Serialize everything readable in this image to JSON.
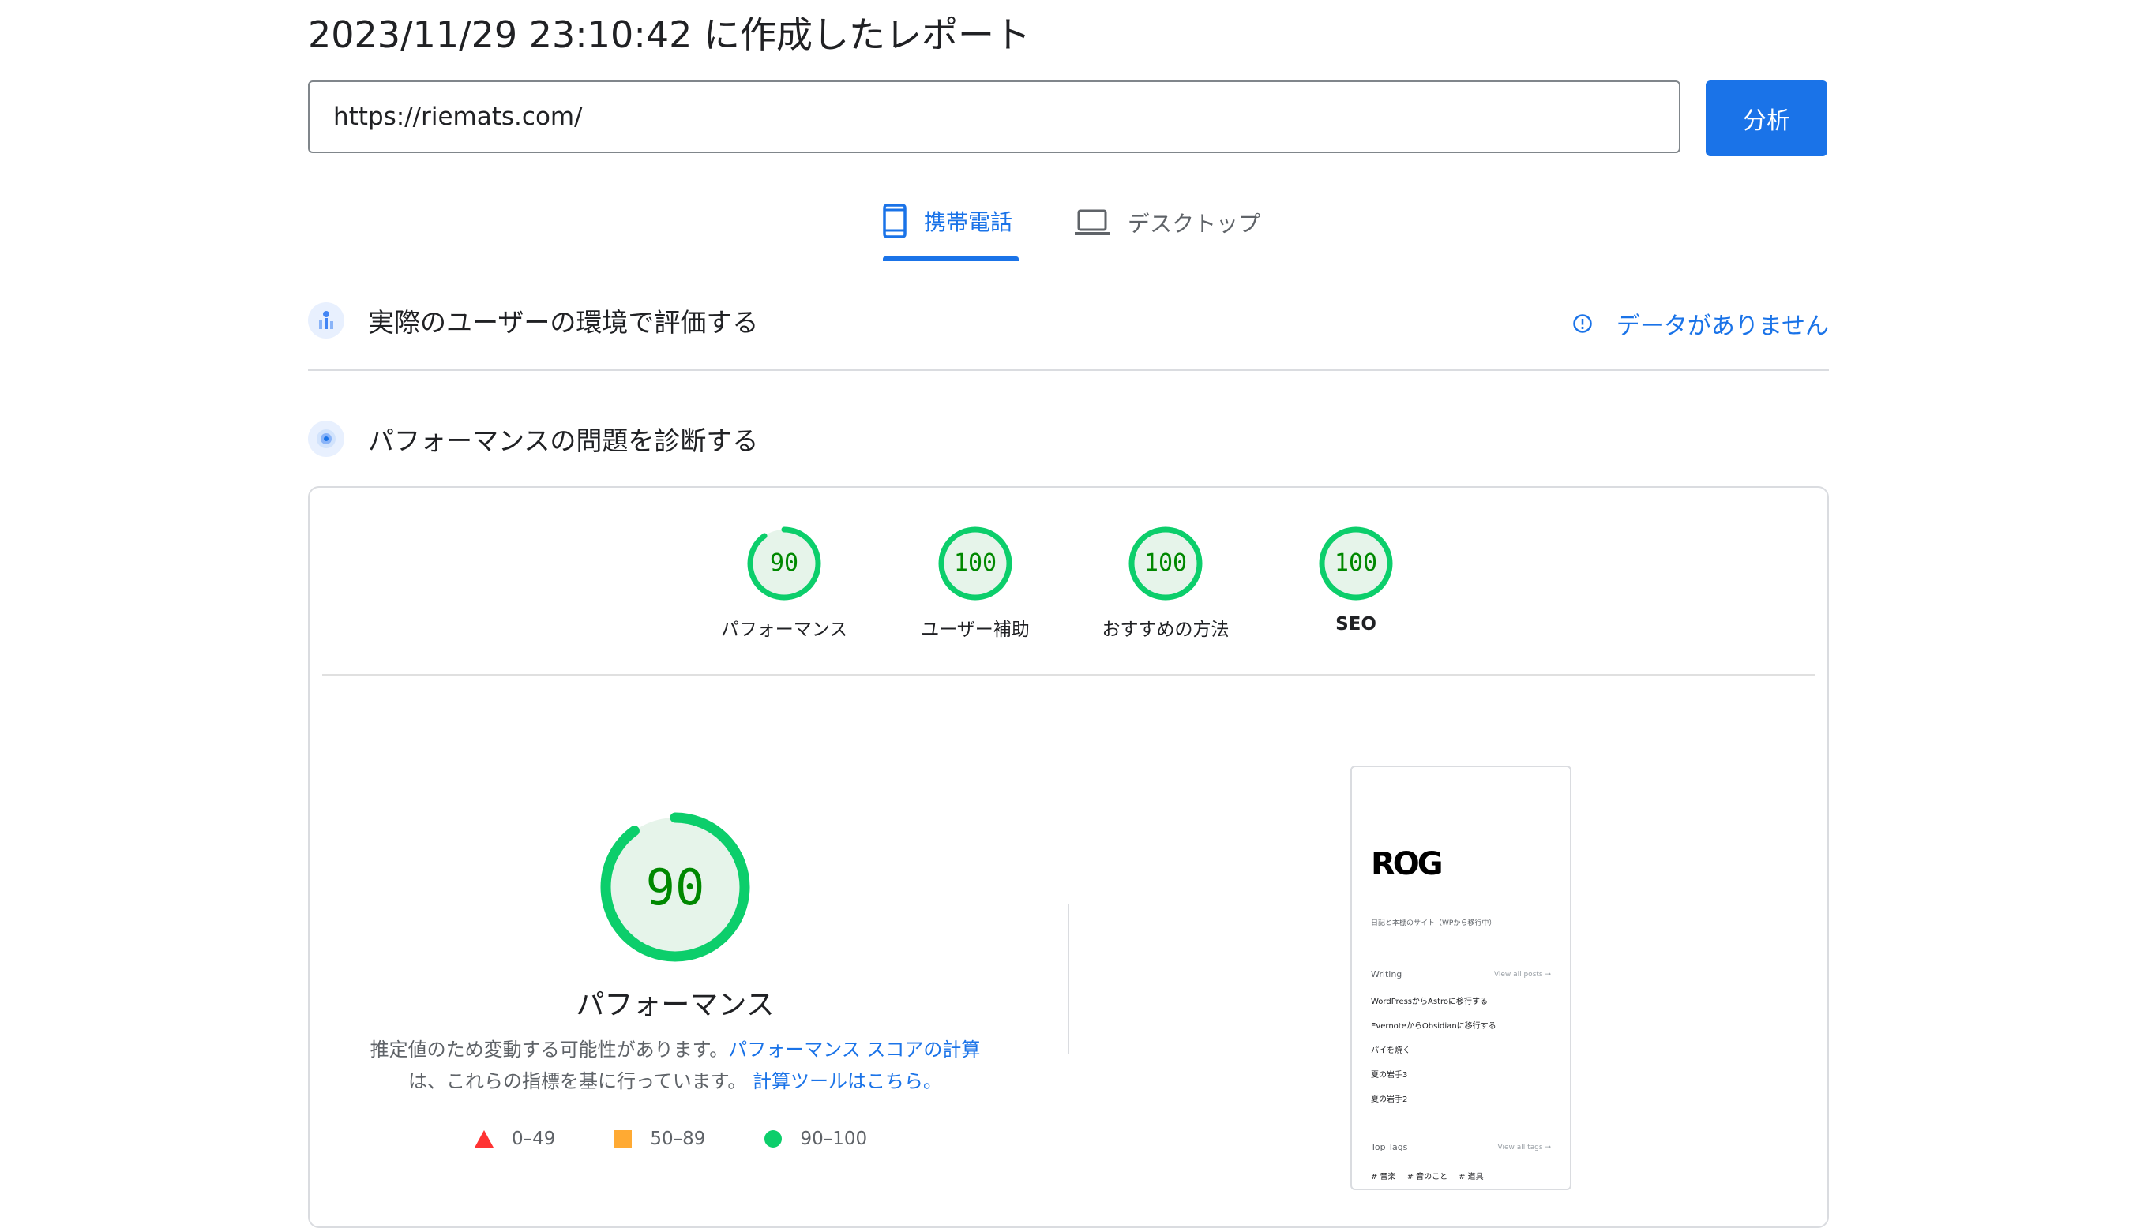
{
  "report": {
    "title": "2023/11/29 23:10:42 に作成したレポート"
  },
  "search": {
    "url_value": "https://riemats.com/",
    "analyze_label": "分析"
  },
  "tabs": [
    {
      "label": "携帯電話",
      "icon": "smartphone-icon",
      "selected": true
    },
    {
      "label": "デスクトップ",
      "icon": "laptop-icon",
      "selected": false
    }
  ],
  "sections": {
    "real_users": {
      "title": "実際のユーザーの環境で評価する",
      "status": "データがありません",
      "status_icon": "info-icon"
    },
    "diagnose": {
      "title": "パフォーマンスの問題を診断する"
    }
  },
  "scores": [
    {
      "label": "パフォーマンス",
      "value": "90",
      "score": 90
    },
    {
      "label": "ユーザー補助",
      "value": "100",
      "score": 100
    },
    {
      "label": "おすすめの方法",
      "value": "100",
      "score": 100
    },
    {
      "label": "SEO",
      "value": "100",
      "score": 100
    }
  ],
  "main_score": {
    "value": "90",
    "score": 90,
    "title": "パフォーマンス",
    "desc_line1": "推定値のため変動する可能性があります。",
    "link1": "パフォーマンス スコアの計算",
    "desc_line2": "は、これらの指標を基に行っています。",
    "link2": "計算ツールはこちら。"
  },
  "legend": [
    {
      "shape": "triangle",
      "range": "0–49",
      "color": "#ff3333"
    },
    {
      "shape": "square",
      "range": "50–89",
      "color": "#ffaa33"
    },
    {
      "shape": "circle",
      "range": "90–100",
      "color": "#0cce6b"
    }
  ],
  "colors": {
    "accent": "#1a73e8",
    "pass": "#0cce6b",
    "pass_text": "#008800",
    "pass_bg": "#e6f4ea"
  },
  "thumbnail": {
    "logo": "ROG",
    "subtitle": "日記と本棚のサイト（WPから移行中）",
    "writing_heading": "Writing",
    "view_all_posts": "View all posts →",
    "posts": [
      "WordPressからAstroに移行する",
      "EvernoteからObsidianに移行する",
      "パイを焼く",
      "夏の岩手3",
      "夏の岩手2"
    ],
    "tags_heading": "Top Tags",
    "view_all_tags": "View all tags →",
    "tags": [
      "# 音楽",
      "# 音のこと",
      "# 道具"
    ]
  }
}
